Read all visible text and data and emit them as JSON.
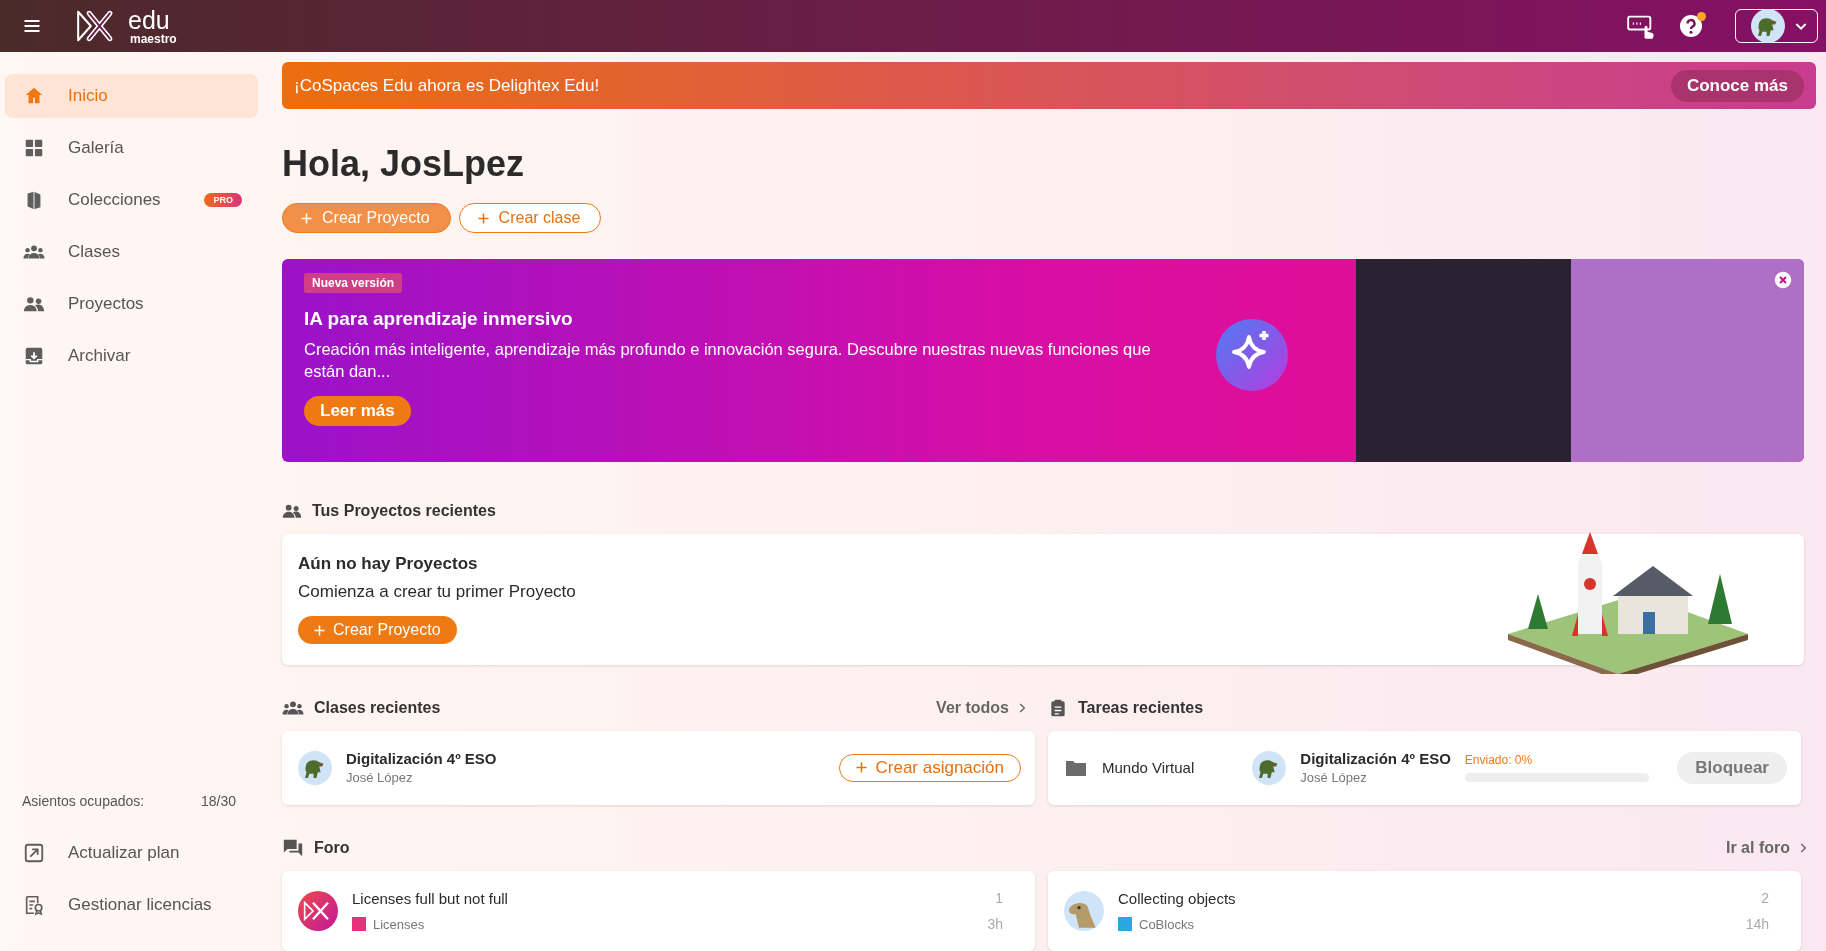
{
  "header": {
    "logo_text": "edu",
    "logo_sub": "maestro",
    "help_notification": true
  },
  "sidebar": {
    "items": [
      {
        "label": "Inicio",
        "selected": true
      },
      {
        "label": "Galería",
        "selected": false
      },
      {
        "label": "Colecciones",
        "selected": false,
        "badge": "PRO"
      },
      {
        "label": "Clases",
        "selected": false
      },
      {
        "label": "Proyectos",
        "selected": false
      },
      {
        "label": "Archivar",
        "selected": false
      }
    ],
    "seats_label": "Asientos ocupados:",
    "seats_value": "18/30",
    "footer_items": [
      {
        "label": "Actualizar plan"
      },
      {
        "label": "Gestionar licencias"
      }
    ]
  },
  "announcement": {
    "text": "¡CoSpaces Edu ahora es Delightex Edu!",
    "button": "Conoce más"
  },
  "greeting": "Hola, JosLpez",
  "actions": [
    {
      "label": "Crear Proyecto",
      "kind": "filled"
    },
    {
      "label": "Crear clase",
      "kind": "outline"
    }
  ],
  "promo": {
    "badge": "Nueva versión",
    "title": "IA para aprendizaje inmersivo",
    "text": "Creación más inteligente, aprendizaje más profundo e innovación segura. Descubre nuestras nuevas funciones que están dan...",
    "button": "Leer más"
  },
  "recent_projects": {
    "title": "Tus Proyectos recientes",
    "empty_title": "Aún no hay Proyectos",
    "empty_text": "Comienza a crear tu primer Proyecto",
    "button": "Crear Proyecto"
  },
  "recent_classes": {
    "title": "Clases recientes",
    "link": "Ver todos",
    "items": [
      {
        "name": "Digitalización 4º ESO",
        "teacher": "José López",
        "button": "Crear asignación"
      }
    ]
  },
  "recent_tasks": {
    "title": "Tareas recientes",
    "items": [
      {
        "name": "Mundo Virtual",
        "class": "Digitalización 4º ESO",
        "teacher": "José López",
        "status": "Enviado: 0%",
        "level": 0,
        "button": "Bloquear"
      }
    ]
  },
  "forum": {
    "title": "Foro",
    "link": "Ir al foro",
    "posts": [
      {
        "title": "Licenses full but not full",
        "category": "Licenses",
        "color": "#e5307c",
        "count": "1",
        "time": "3h"
      },
      {
        "title": "Collecting objects",
        "category": "CoBlocks",
        "color": "#29a8e0",
        "count": "2",
        "time": "14h"
      }
    ]
  }
}
